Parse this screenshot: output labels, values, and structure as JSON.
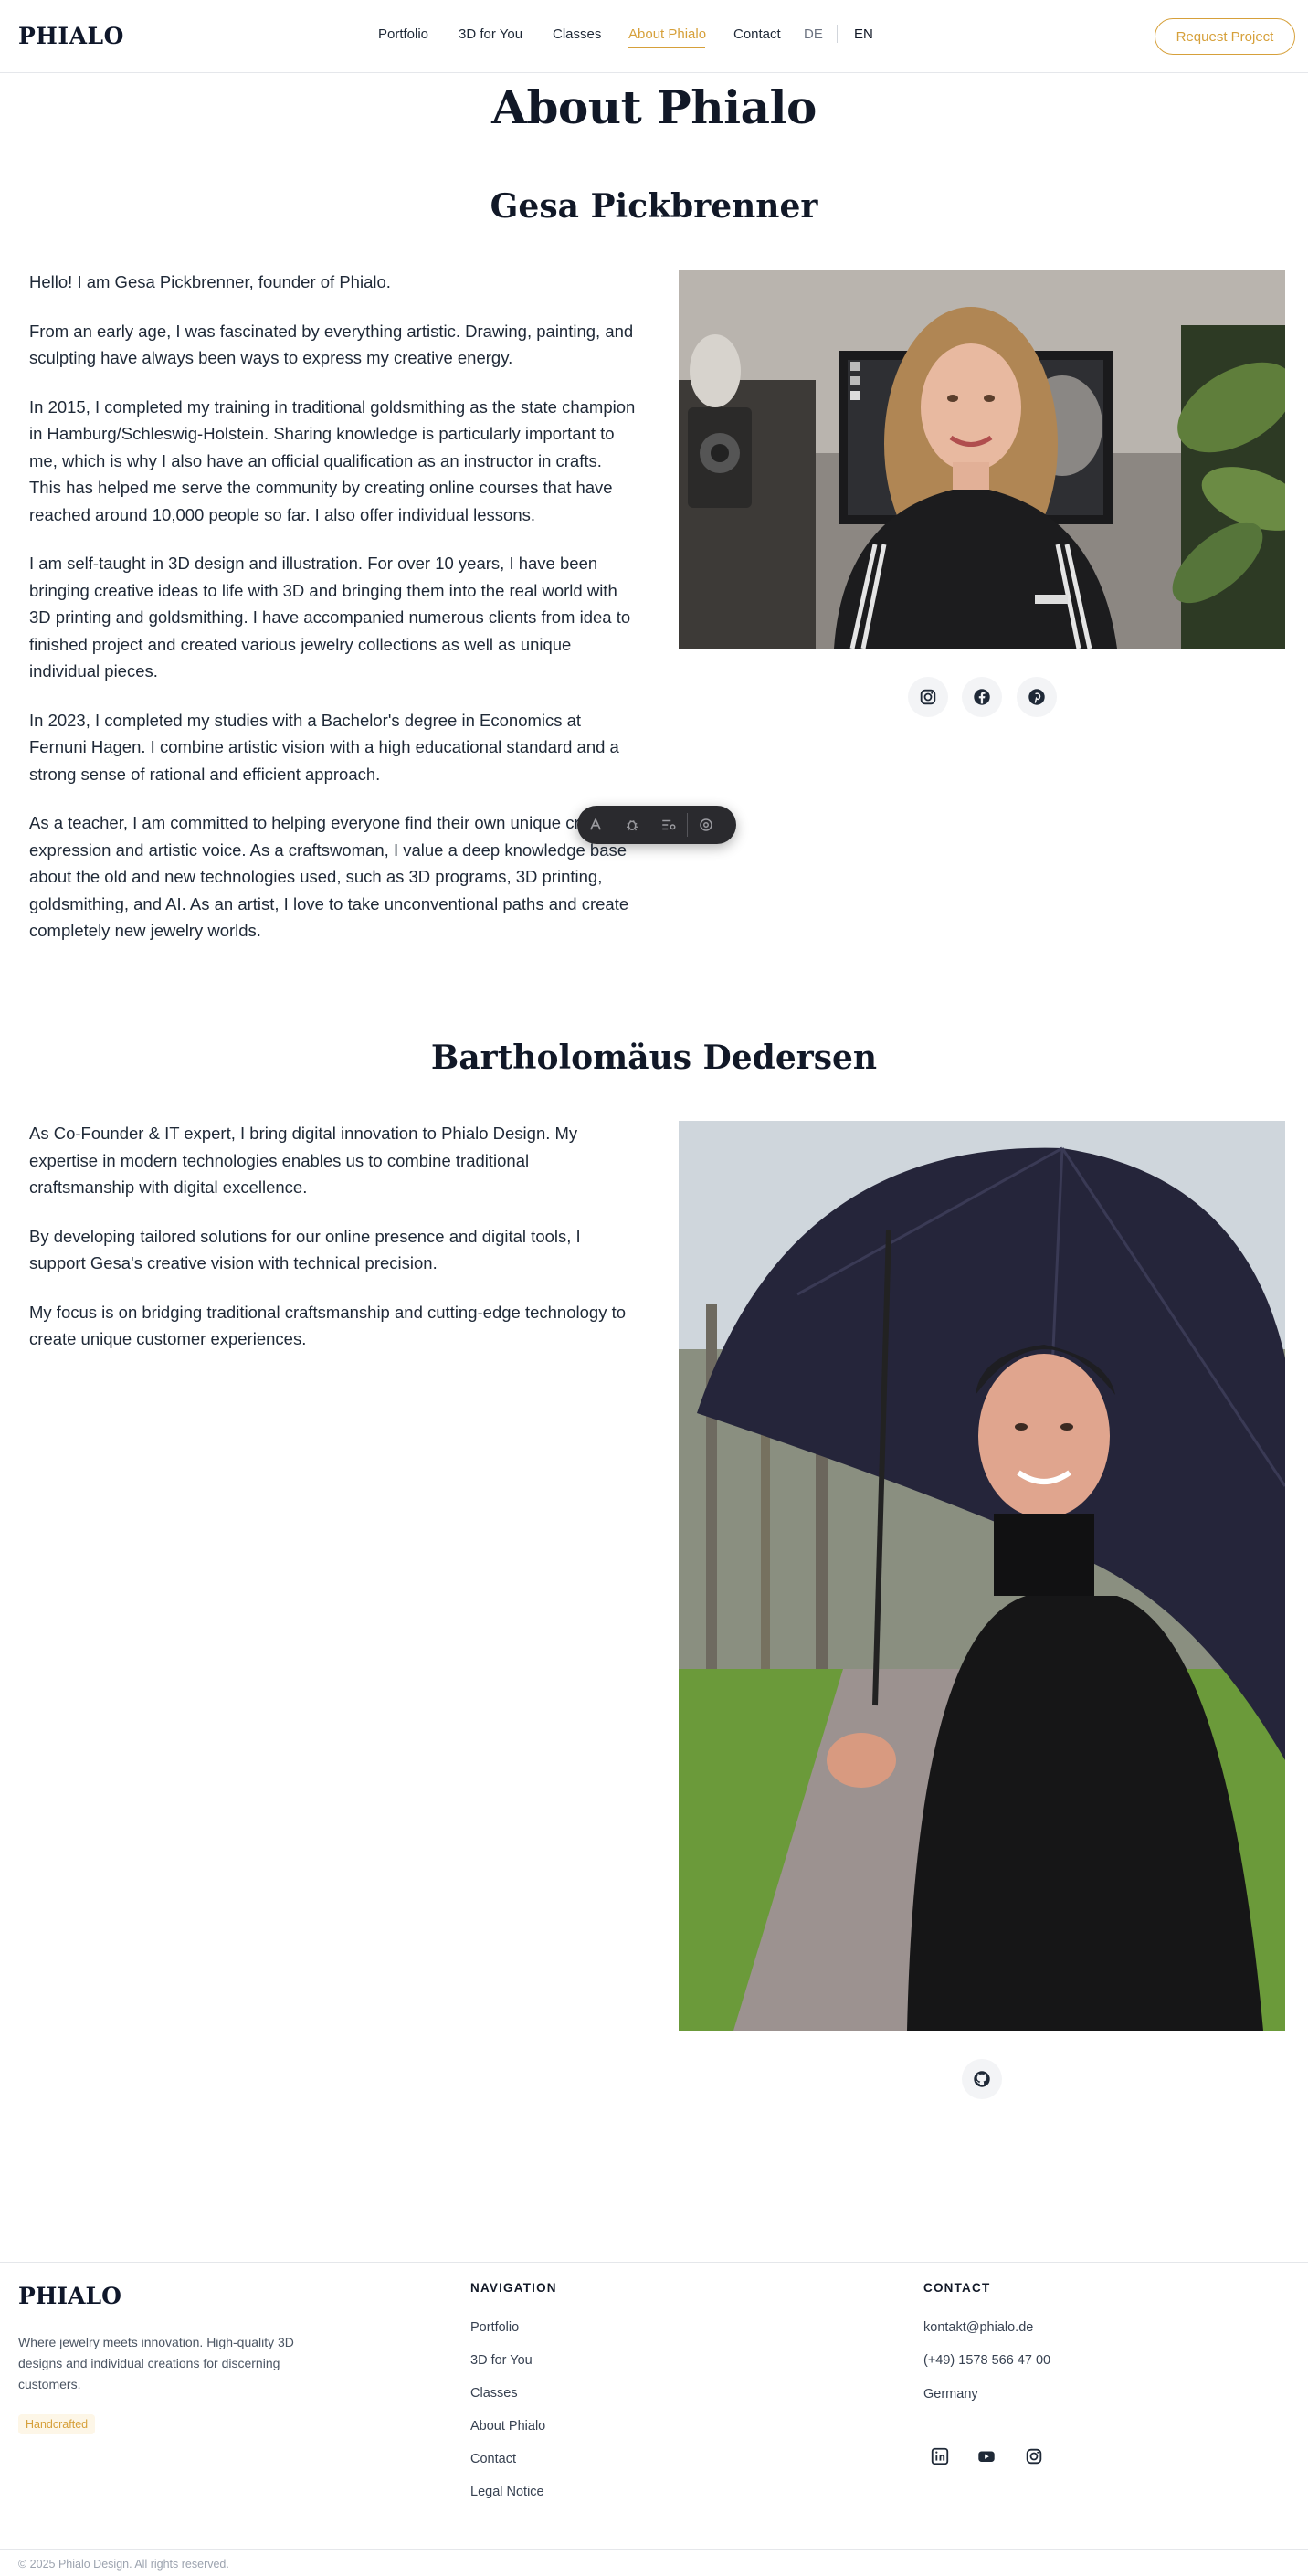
{
  "header": {
    "logo": "PHIALO",
    "nav": [
      {
        "label": "Portfolio"
      },
      {
        "label": "3D for You"
      },
      {
        "label": "Classes"
      },
      {
        "label": "About Phialo"
      },
      {
        "label": "Contact"
      }
    ],
    "active_nav": "About Phialo",
    "languages": [
      "DE",
      "EN"
    ],
    "active_language": "EN",
    "cta": "Request Project"
  },
  "page": {
    "title": "About Phialo"
  },
  "gesa": {
    "name": "Gesa Pickbrenner",
    "paragraphs": [
      "Hello! I am Gesa Pickbrenner, founder of Phialo.",
      "From an early age, I was fascinated by everything artistic. Drawing, painting, and sculpting have always been ways to express my creative energy.",
      "In 2015, I completed my training in traditional goldsmithing as the state champion in Hamburg/Schleswig-Holstein. Sharing knowledge is particularly important to me, which is why I also have an official qualification as an instructor in crafts. This has helped me serve the community by creating online courses that have reached around 10,000 people so far. I also offer individual lessons.",
      "I am self-taught in 3D design and illustration. For over 10 years, I have been bringing creative ideas to life with 3D and bringing them into the real world with 3D printing and goldsmithing. I have accompanied numerous clients from idea to finished project and created various jewelry collections as well as unique individual pieces.",
      "In 2023, I completed my studies with a Bachelor's degree in Economics at Fernuni Hagen. I combine artistic vision with a high educational standard and a strong sense of rational and efficient approach.",
      "As a teacher, I am committed to helping everyone find their own unique creative expression and artistic voice. As a craftswoman, I value a deep knowledge base about the old and new technologies used, such as 3D programs, 3D printing, goldsmithing, and AI. As an artist, I love to take unconventional paths and create completely new jewelry worlds."
    ],
    "social_icons": [
      "instagram-icon",
      "facebook-icon",
      "pinterest-icon"
    ]
  },
  "bartholomaus": {
    "name": "Bartholomäus Dedersen",
    "paragraphs": [
      "As Co-Founder & IT expert, I bring digital innovation to Phialo Design. My expertise in modern technologies enables us to combine traditional craftsmanship with digital excellence.",
      "By developing tailored solutions for our online presence and digital tools, I support Gesa's creative vision with technical precision.",
      "My focus is on bridging traditional craftsmanship and cutting-edge technology to create unique customer experiences."
    ],
    "social_icons": [
      "github-icon"
    ]
  },
  "toolbar": {
    "icons": [
      "pen-icon",
      "bug-icon",
      "list-settings-icon",
      "settings-icon"
    ]
  },
  "footer": {
    "logo": "PHIALO",
    "tagline": "Where jewelry meets innovation. High-quality 3D designs and individual creations for discerning customers.",
    "badge": "Handcrafted",
    "navigation_heading": "NAVIGATION",
    "navigation_links": [
      "Portfolio",
      "3D for You",
      "Classes",
      "About Phialo",
      "Contact",
      "Legal Notice"
    ],
    "contact_heading": "CONTACT",
    "email": "kontakt@phialo.de",
    "phone": "(+49) 1578 566 47 00",
    "country": "Germany",
    "social_icons": [
      "linkedin-icon",
      "youtube-icon",
      "instagram-icon"
    ],
    "copyright": "© 2025 Phialo Design. All rights reserved."
  },
  "colors": {
    "accent": "#d6a03a",
    "heading": "#111827",
    "text": "#1f2937"
  }
}
